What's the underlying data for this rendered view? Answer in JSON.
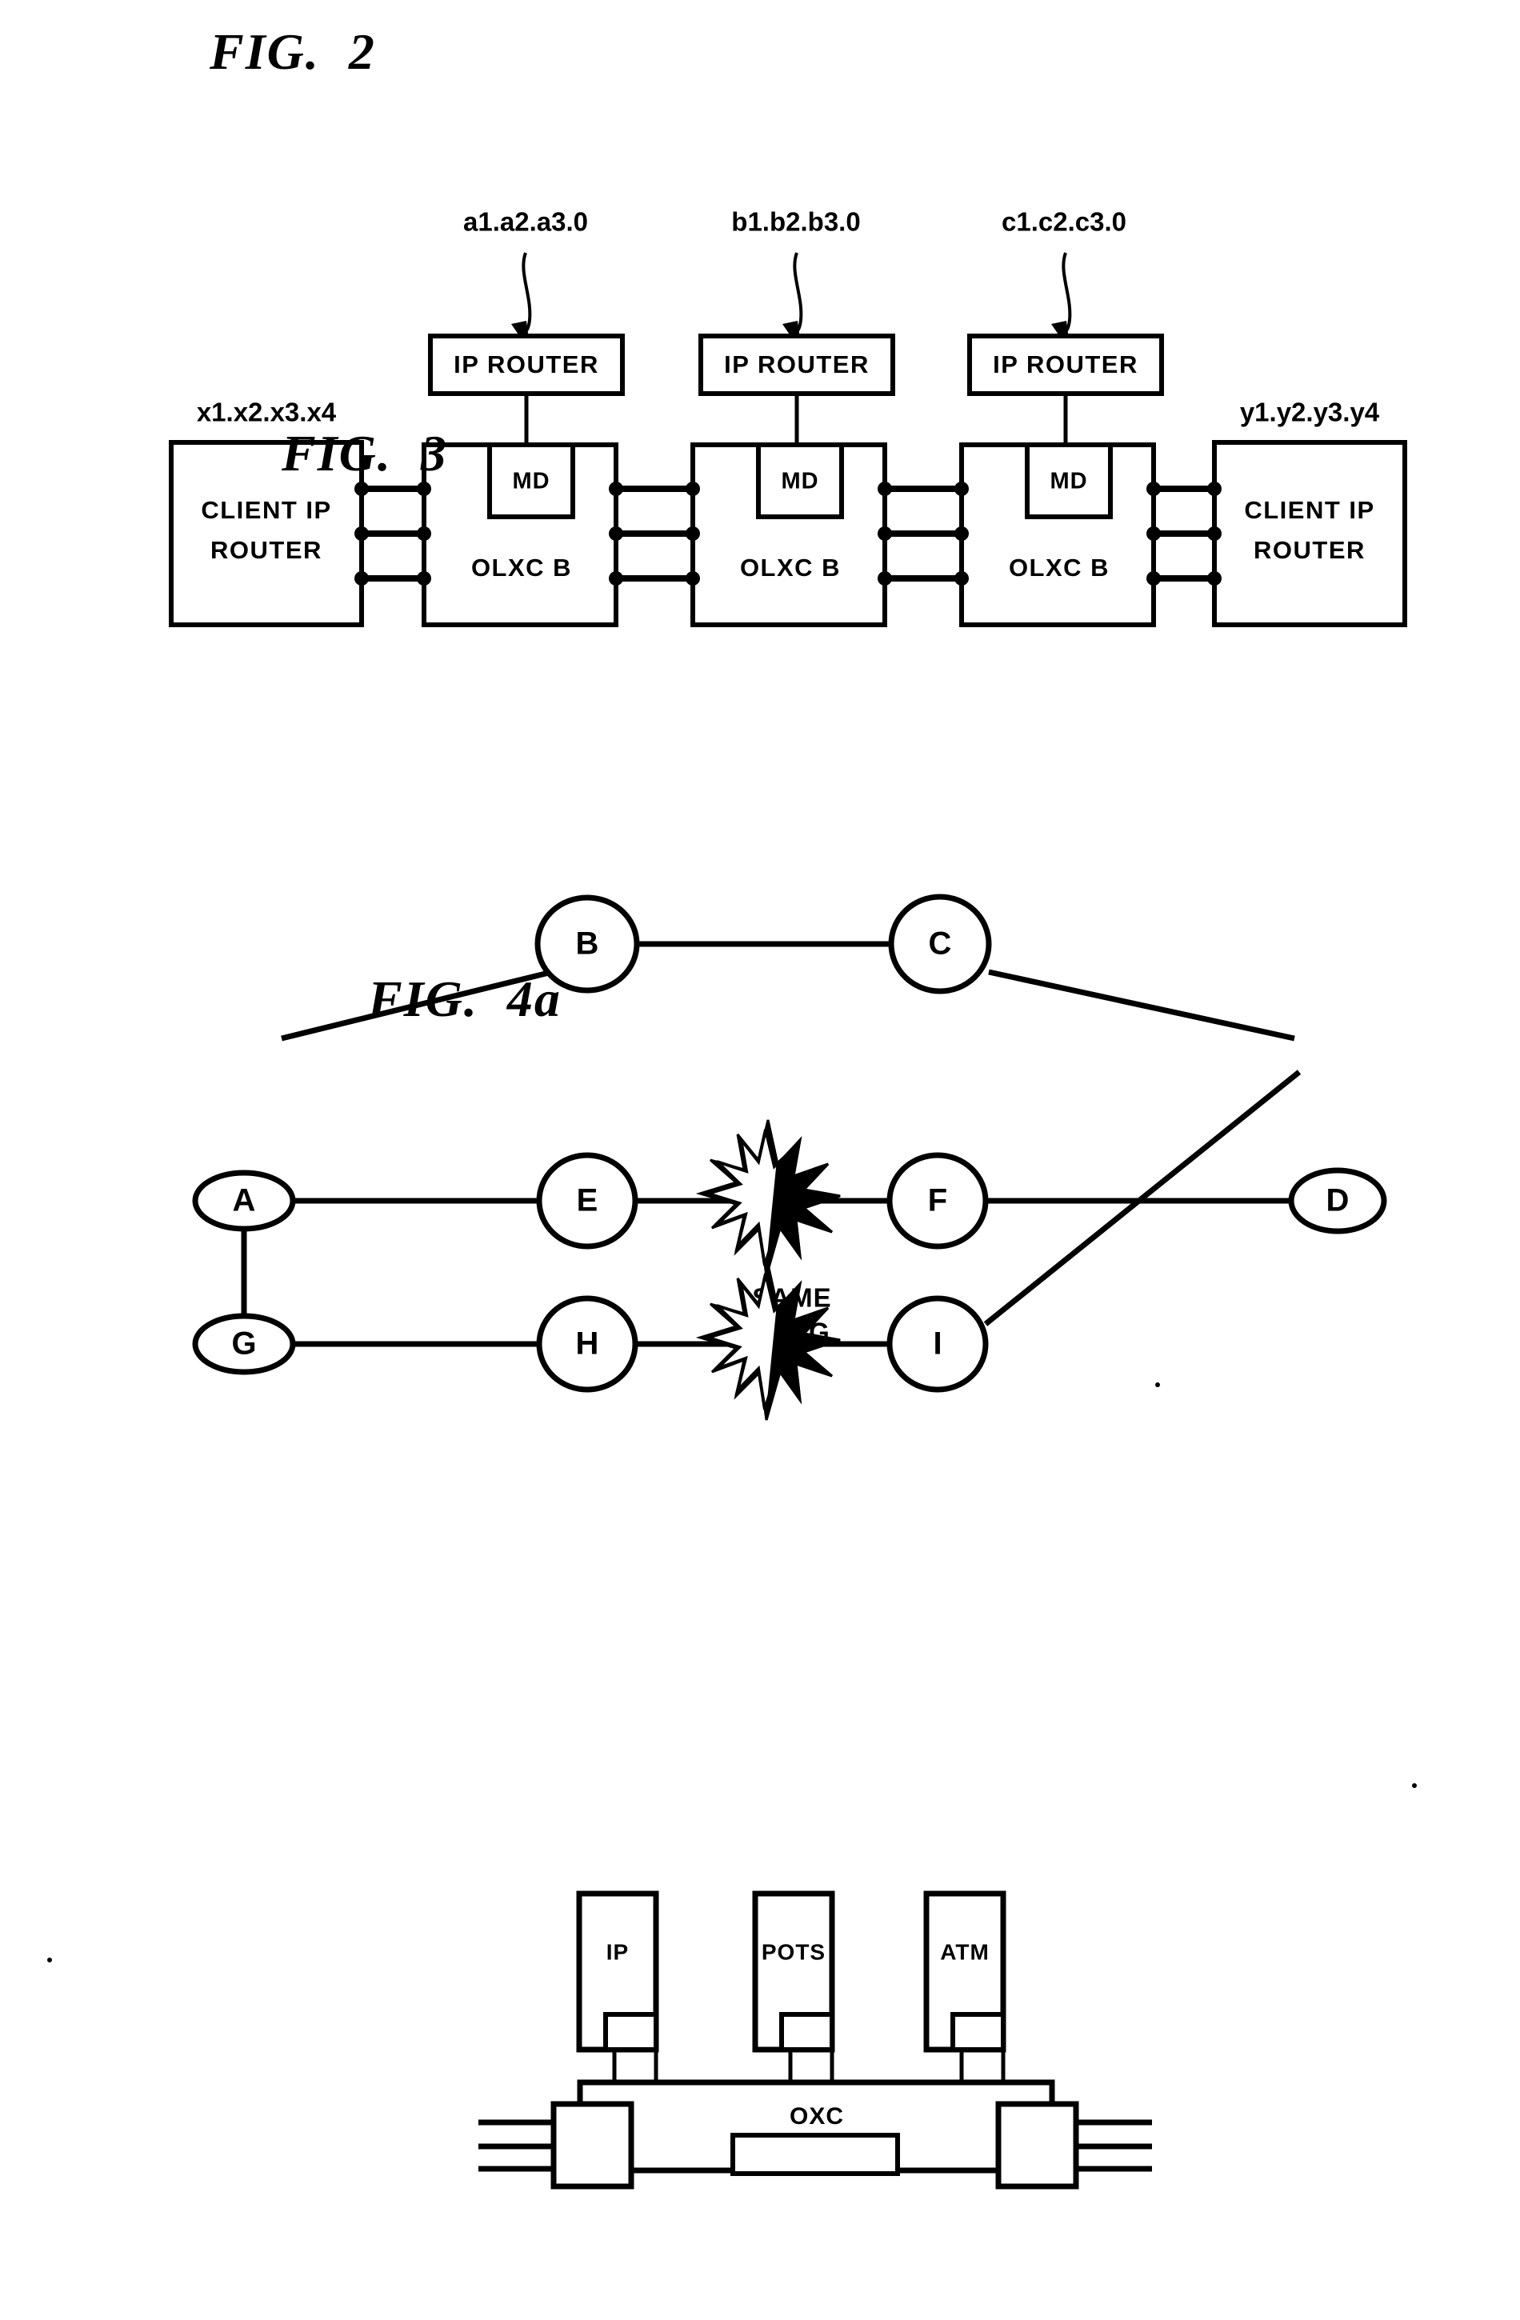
{
  "figures": {
    "fig2": {
      "title": "FIG.  2",
      "subnet_labels": [
        "a1.a2.a3.0",
        "b1.b2.b3.0",
        "c1.c2.c3.0"
      ],
      "client_left_addr": "x1.x2.x3.x4",
      "client_right_addr": "y1.y2.y3.y4",
      "ip_router_label": "IP ROUTER",
      "md_label": "MD",
      "olxc_label": "OLXC B",
      "client_router_line1": "CLIENT IP",
      "client_router_line2": "ROUTER",
      "num_ip_routers": 3,
      "num_olxc": 3,
      "links_per_bundle": 3
    },
    "fig3": {
      "title": "FIG.  3",
      "nodes": [
        "A",
        "B",
        "C",
        "D",
        "E",
        "F",
        "G",
        "H",
        "I"
      ],
      "annotation_line1": "SAME",
      "annotation_line2": "SRLG",
      "edges": [
        [
          "A",
          "B"
        ],
        [
          "B",
          "C"
        ],
        [
          "C",
          "D"
        ],
        [
          "A",
          "E"
        ],
        [
          "E",
          "F"
        ],
        [
          "F",
          "D"
        ],
        [
          "A",
          "G"
        ],
        [
          "G",
          "H"
        ],
        [
          "H",
          "I"
        ],
        [
          "I",
          "D"
        ]
      ],
      "failure_markers": [
        {
          "between": "E-F",
          "label": "SAME SRLG"
        },
        {
          "between": "H-I",
          "label": "SAME SRLG"
        }
      ]
    },
    "fig4a": {
      "title": "FIG.  4a",
      "service_modules": [
        "IP",
        "POTS",
        "ATM"
      ],
      "switch_label": "OXC",
      "left_fibers": 3,
      "right_fibers": 3
    }
  }
}
